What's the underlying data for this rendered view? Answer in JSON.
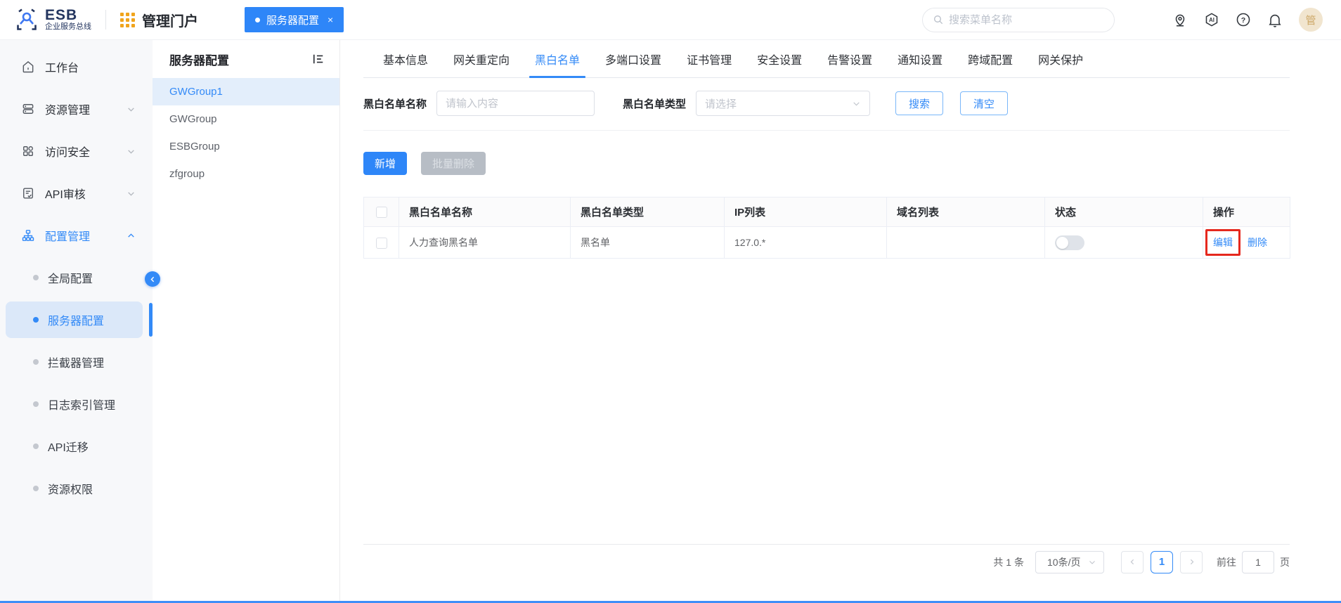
{
  "colors": {
    "primary": "#338af7",
    "tab_chip": "#2e86f8",
    "active_item_bg": "#dbe8f9",
    "group_active_bg": "#e3eefb",
    "disabled_button_bg": "#b7bdc5",
    "table_border": "#ebeef5",
    "annotation_red": "#e5281e",
    "logo_orange": "#f0a41c",
    "logo_navy": "#23355f"
  },
  "header": {
    "logo_title": "ESB",
    "logo_subtitle": "企业服务总线",
    "portal_title": "管理门户",
    "open_tab": {
      "label": "服务器配置",
      "close": "×"
    },
    "search_placeholder": "搜索菜单名称",
    "icons": [
      "location-icon",
      "ai-icon",
      "help-icon",
      "bell-icon"
    ],
    "avatar_text": "管"
  },
  "sidebar": {
    "items": [
      {
        "label": "工作台",
        "icon": "home-icon",
        "expandable": false
      },
      {
        "label": "资源管理",
        "icon": "resource-icon",
        "expandable": true
      },
      {
        "label": "访问安全",
        "icon": "access-security-icon",
        "expandable": true
      },
      {
        "label": "API审核",
        "icon": "api-audit-icon",
        "expandable": true
      },
      {
        "label": "配置管理",
        "icon": "config-icon",
        "expandable": true,
        "expanded": true,
        "active": true
      }
    ],
    "sub_items": [
      {
        "label": "全局配置",
        "active": false
      },
      {
        "label": "服务器配置",
        "active": true
      },
      {
        "label": "拦截器管理",
        "active": false
      },
      {
        "label": "日志索引管理",
        "active": false
      },
      {
        "label": "API迁移",
        "active": false
      },
      {
        "label": "资源权限",
        "active": false
      }
    ]
  },
  "group_panel": {
    "title": "服务器配置",
    "items": [
      {
        "label": "GWGroup1",
        "active": true
      },
      {
        "label": "GWGroup",
        "active": false
      },
      {
        "label": "ESBGroup",
        "active": false
      },
      {
        "label": "zfgroup",
        "active": false
      }
    ]
  },
  "main": {
    "tabs": [
      {
        "label": "基本信息"
      },
      {
        "label": "网关重定向"
      },
      {
        "label": "黑白名单",
        "active": true
      },
      {
        "label": "多端口设置"
      },
      {
        "label": "证书管理"
      },
      {
        "label": "安全设置"
      },
      {
        "label": "告警设置"
      },
      {
        "label": "通知设置"
      },
      {
        "label": "跨域配置"
      },
      {
        "label": "网关保护"
      }
    ],
    "filters": {
      "name_label": "黑白名单名称",
      "name_placeholder": "请输入内容",
      "name_value": "",
      "type_label": "黑白名单类型",
      "type_placeholder": "请选择",
      "search_button": "搜索",
      "clear_button": "清空"
    },
    "actions": {
      "add_button": "新增",
      "batch_delete_button": "批量删除"
    },
    "table": {
      "columns": [
        "黑白名单名称",
        "黑白名单类型",
        "IP列表",
        "域名列表",
        "状态",
        "操作"
      ],
      "rows": [
        {
          "name": "人力查询黑名单",
          "type": "黑名单",
          "ip_list": "127.0.*",
          "domain_list": "",
          "status_on": false,
          "edit_label": "编辑",
          "delete_label": "删除"
        }
      ]
    },
    "pagination": {
      "total_text": "共 1 条",
      "page_size": "10条/页",
      "current_page": "1",
      "goto_label": "前往",
      "goto_value": "1",
      "page_unit": "页"
    }
  }
}
